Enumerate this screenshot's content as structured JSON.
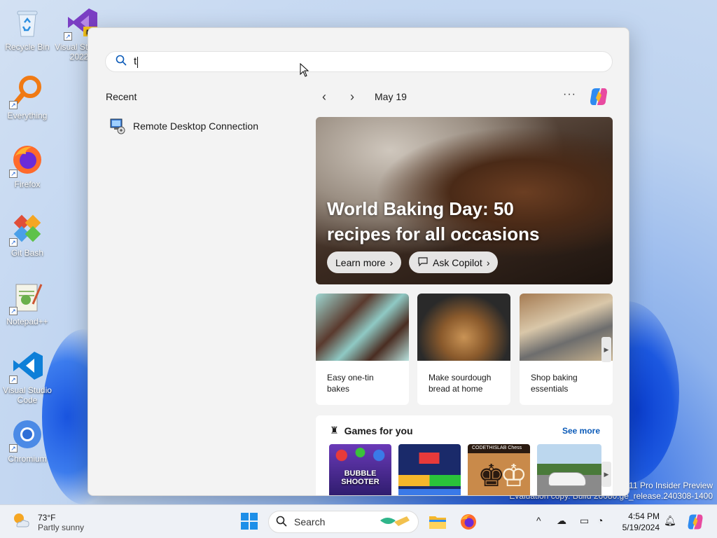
{
  "desktop": {
    "icons": [
      {
        "label": "Recycle Bin"
      },
      {
        "label": "Visual Studio 2022 Preview"
      },
      {
        "label": "Everything"
      },
      {
        "label": "Firefox"
      },
      {
        "label": "Git Bash"
      },
      {
        "label": "Notepad++"
      },
      {
        "label": "Visual Studio Code"
      },
      {
        "label": "Chromium"
      }
    ],
    "watermark_line1": "Windows 11 Pro Insider Preview",
    "watermark_line2": "Evaluation copy. Build 26080.ge_release.240308-1400"
  },
  "start_menu": {
    "search": {
      "value": "t"
    },
    "recent": {
      "title": "Recent",
      "items": [
        {
          "label": "Remote Desktop Connection"
        }
      ]
    },
    "feed": {
      "date": "May 19",
      "more_label": "···",
      "hero": {
        "title": "World Baking Day: 50 recipes for all occasions",
        "learn_more": "Learn more",
        "ask_copilot": "Ask Copilot"
      },
      "cards": [
        {
          "caption": "Easy one-tin bakes"
        },
        {
          "caption": "Make sourdough bread at home"
        },
        {
          "caption": "Shop baking essentials"
        }
      ],
      "games": {
        "title": "Games for you",
        "see_more": "See more",
        "items": [
          {
            "name": "BUBBLE SHOOTER"
          },
          {
            "name": "Blocks"
          },
          {
            "name": "CODETHISLAB Chess"
          },
          {
            "name": "Car racing"
          }
        ]
      }
    }
  },
  "taskbar": {
    "weather": {
      "temp": "73°F",
      "condition": "Partly sunny"
    },
    "search_label": "Search",
    "time": "4:54 PM",
    "date": "5/19/2024"
  },
  "colors": {
    "accent": "#0a5ab8",
    "start_bg": "#f3f3f3",
    "taskbar_bg": "#eef1f6"
  }
}
